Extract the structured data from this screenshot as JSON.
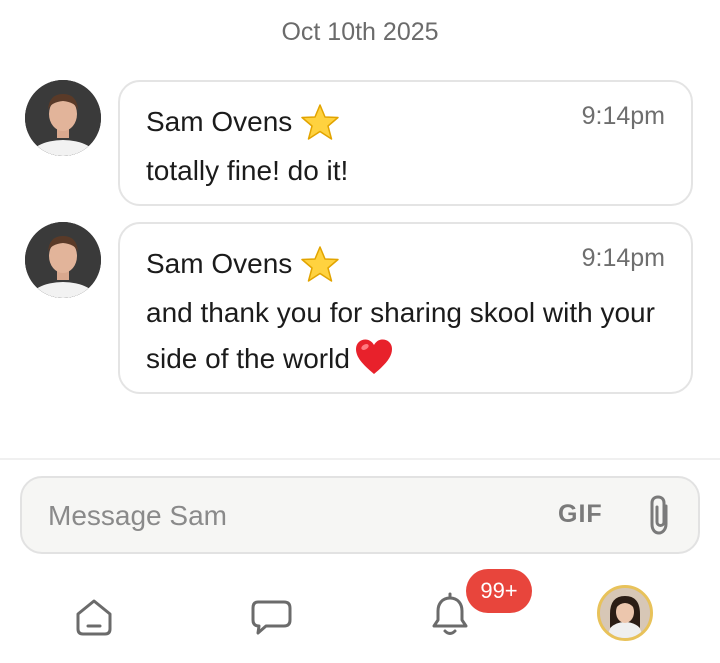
{
  "date_separator": "Oct 10th 2025",
  "messages": [
    {
      "sender": "Sam Ovens",
      "badge_icon": "star-icon",
      "time": "9:14pm",
      "text": "totally fine! do it!"
    },
    {
      "sender": "Sam Ovens",
      "badge_icon": "star-icon",
      "time": "9:14pm",
      "text": "and thank you for sharing skool with your side of the world",
      "trailing_icon": "red-heart-icon"
    }
  ],
  "composer": {
    "placeholder": "Message Sam",
    "gif_label": "GIF",
    "attach_icon": "paperclip-icon"
  },
  "nav": {
    "items": [
      {
        "name": "home",
        "icon": "home-icon"
      },
      {
        "name": "chat",
        "icon": "chat-bubble-icon"
      },
      {
        "name": "notifications",
        "icon": "bell-icon"
      },
      {
        "name": "profile",
        "icon": "user-avatar"
      }
    ],
    "notification_badge": "99+"
  },
  "colors": {
    "badge_red": "#e8453c",
    "avatar_ring": "#e8c25a",
    "bubble_border": "#e4e4e4",
    "composer_bg": "#f6f6f4"
  }
}
